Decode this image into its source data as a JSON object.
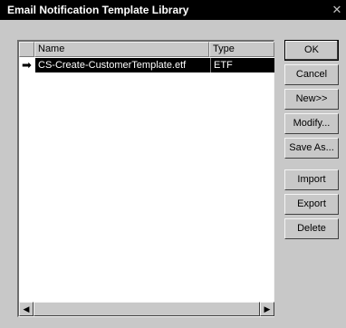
{
  "window": {
    "title": "Email Notification Template Library",
    "close_glyph": "✕"
  },
  "list": {
    "columns": [
      "Name",
      "Type"
    ],
    "rows": [
      {
        "name": "CS-Create-CustomerTemplate.etf",
        "type": "ETF",
        "selected": true
      }
    ],
    "current_row_glyph": "➡"
  },
  "scrollbar": {
    "left_glyph": "◀",
    "right_glyph": "▶"
  },
  "buttons": {
    "ok": "OK",
    "cancel": "Cancel",
    "new": "New>>",
    "modify": "Modify...",
    "save_as": "Save As...",
    "import": "Import",
    "export": "Export",
    "delete": "Delete"
  },
  "colors": {
    "selection_bg": "#000000",
    "selection_fg": "#ffffff",
    "face": "#c8c8c8"
  }
}
